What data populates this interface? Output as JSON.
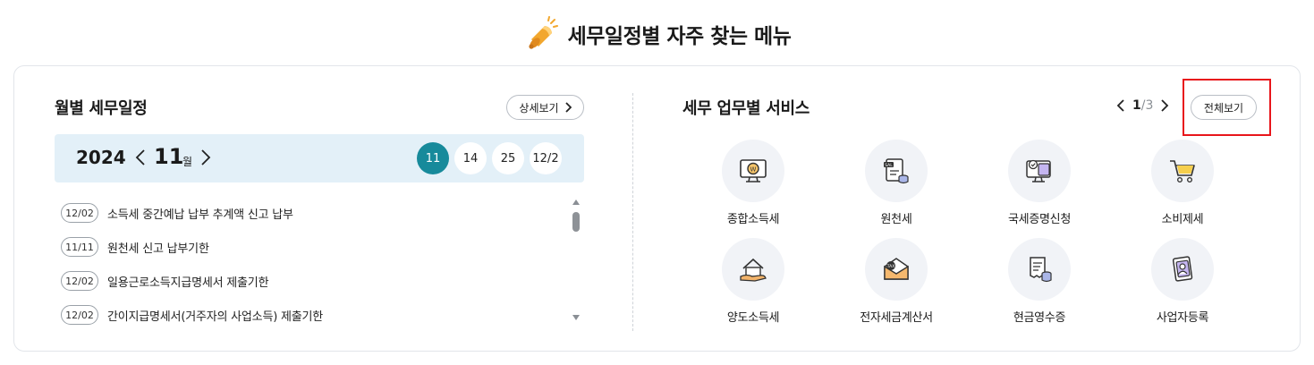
{
  "header": {
    "title": "세무일정별 자주 찾는 메뉴"
  },
  "schedule_panel": {
    "title": "월별 세무일정",
    "detail_label": "상세보기",
    "year": "2024",
    "month": "11",
    "month_unit": "월",
    "dates": [
      "11",
      "14",
      "25",
      "12/2"
    ],
    "items": [
      {
        "date": "12/02",
        "text": "소득세 중간예납 납부 추계액 신고 납부"
      },
      {
        "date": "11/11",
        "text": "원천세 신고 납부기한"
      },
      {
        "date": "12/02",
        "text": "일용근로소득지급명세서 제출기한"
      },
      {
        "date": "12/02",
        "text": "간이지급명세서(거주자의 사업소득) 제출기한"
      }
    ]
  },
  "service_panel": {
    "title": "세무 업무별 서비스",
    "page_current": "1",
    "page_sep": "/",
    "page_total": "3",
    "all_label": "전체보기",
    "services": [
      {
        "label": "종합소득세",
        "icon": "monitor-won-icon"
      },
      {
        "label": "원천세",
        "icon": "sal-document-coins-icon"
      },
      {
        "label": "국세증명신청",
        "icon": "monitor-certificate-icon"
      },
      {
        "label": "소비제세",
        "icon": "shopping-cart-icon"
      },
      {
        "label": "양도소득세",
        "icon": "house-hand-icon"
      },
      {
        "label": "전자세금계산서",
        "icon": "tax-envelope-icon"
      },
      {
        "label": "현금영수증",
        "icon": "receipt-coins-icon"
      },
      {
        "label": "사업자등록",
        "icon": "id-card-person-icon"
      }
    ]
  },
  "colors": {
    "accent": "#178a9b",
    "month_bar_bg": "#e3f0f8",
    "icon_bg": "#f1f3f7",
    "highlight_box": "#e8161b"
  }
}
